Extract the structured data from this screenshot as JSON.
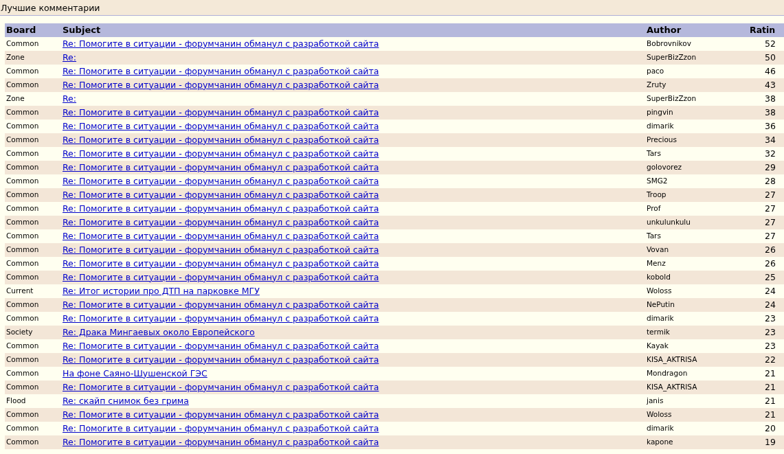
{
  "title": "Лучшие комментарии",
  "table": {
    "columns": [
      "Board",
      "Subject",
      "Author",
      "Ratin"
    ],
    "rows": [
      {
        "board": "Common",
        "subject": "Re: Помогите в ситуации - форумчанин обманул с разработкой сайта",
        "author": "Bobrovnikov",
        "rating": "52"
      },
      {
        "board": "Zone",
        "subject": "Re:",
        "author": "SuperBizZzon",
        "rating": "50"
      },
      {
        "board": "Common",
        "subject": "Re: Помогите в ситуации - форумчанин обманул с разработкой сайта",
        "author": "paco",
        "rating": "46"
      },
      {
        "board": "Common",
        "subject": "Re: Помогите в ситуации - форумчанин обманул с разработкой сайта",
        "author": "Zruty",
        "rating": "43"
      },
      {
        "board": "Zone",
        "subject": "Re:",
        "author": "SuperBizZzon",
        "rating": "38"
      },
      {
        "board": "Common",
        "subject": "Re: Помогите в ситуации - форумчанин обманул с разработкой сайта",
        "author": "pingvin",
        "rating": "38"
      },
      {
        "board": "Common",
        "subject": "Re: Помогите в ситуации - форумчанин обманул с разработкой сайта",
        "author": "dimarik",
        "rating": "36"
      },
      {
        "board": "Common",
        "subject": "Re: Помогите в ситуации - форумчанин обманул с разработкой сайта",
        "author": "Precious",
        "rating": "34"
      },
      {
        "board": "Common",
        "subject": "Re: Помогите в ситуации - форумчанин обманул с разработкой сайта",
        "author": "Tars",
        "rating": "32"
      },
      {
        "board": "Common",
        "subject": "Re: Помогите в ситуации - форумчанин обманул с разработкой сайта",
        "author": "golovorez",
        "rating": "29"
      },
      {
        "board": "Common",
        "subject": "Re: Помогите в ситуации - форумчанин обманул с разработкой сайта",
        "author": "SMG2",
        "rating": "28"
      },
      {
        "board": "Common",
        "subject": "Re: Помогите в ситуации - форумчанин обманул с разработкой сайта",
        "author": "Troop",
        "rating": "27"
      },
      {
        "board": "Common",
        "subject": "Re: Помогите в ситуации - форумчанин обманул с разработкой сайта",
        "author": "Prof",
        "rating": "27"
      },
      {
        "board": "Common",
        "subject": "Re: Помогите в ситуации - форумчанин обманул с разработкой сайта",
        "author": "unkulunkulu",
        "rating": "27"
      },
      {
        "board": "Common",
        "subject": "Re: Помогите в ситуации - форумчанин обманул с разработкой сайта",
        "author": "Tars",
        "rating": "27"
      },
      {
        "board": "Common",
        "subject": "Re: Помогите в ситуации - форумчанин обманул с разработкой сайта",
        "author": "Vovan",
        "rating": "26"
      },
      {
        "board": "Common",
        "subject": "Re: Помогите в ситуации - форумчанин обманул с разработкой сайта",
        "author": "Menz",
        "rating": "26"
      },
      {
        "board": "Common",
        "subject": "Re: Помогите в ситуации - форумчанин обманул с разработкой сайта",
        "author": "kobold",
        "rating": "25"
      },
      {
        "board": "Current",
        "subject": "Re: Итог истории про ДТП на парковке МГУ",
        "author": "Woloss",
        "rating": "24"
      },
      {
        "board": "Common",
        "subject": "Re: Помогите в ситуации - форумчанин обманул с разработкой сайта",
        "author": "NePutin",
        "rating": "24"
      },
      {
        "board": "Common",
        "subject": "Re: Помогите в ситуации - форумчанин обманул с разработкой сайта",
        "author": "dimarik",
        "rating": "23"
      },
      {
        "board": "Society",
        "subject": "Re: Драка Мингаевых около Европейского",
        "author": "termik",
        "rating": "23"
      },
      {
        "board": "Common",
        "subject": "Re: Помогите в ситуации - форумчанин обманул с разработкой сайта",
        "author": "Kayak",
        "rating": "23"
      },
      {
        "board": "Common",
        "subject": "Re: Помогите в ситуации - форумчанин обманул с разработкой сайта",
        "author": "KISA_AKTRISA",
        "rating": "22"
      },
      {
        "board": "Common",
        "subject": "На фоне Саяно-Шушенской ГЭС",
        "author": "Mondragon",
        "rating": "21"
      },
      {
        "board": "Common",
        "subject": "Re: Помогите в ситуации - форумчанин обманул с разработкой сайта",
        "author": "KISA_AKTRISA",
        "rating": "21"
      },
      {
        "board": "Flood",
        "subject": "Re: скайп снимок без грима",
        "author": "janis",
        "rating": "21"
      },
      {
        "board": "Common",
        "subject": "Re: Помогите в ситуации - форумчанин обманул с разработкой сайта",
        "author": "Woloss",
        "rating": "21"
      },
      {
        "board": "Common",
        "subject": "Re: Помогите в ситуации - форумчанин обманул с разработкой сайта",
        "author": "dimarik",
        "rating": "20"
      },
      {
        "board": "Common",
        "subject": "Re: Помогите в ситуации - форумчанин обманул с разработкой сайта",
        "author": "kapone",
        "rating": "19"
      }
    ]
  }
}
